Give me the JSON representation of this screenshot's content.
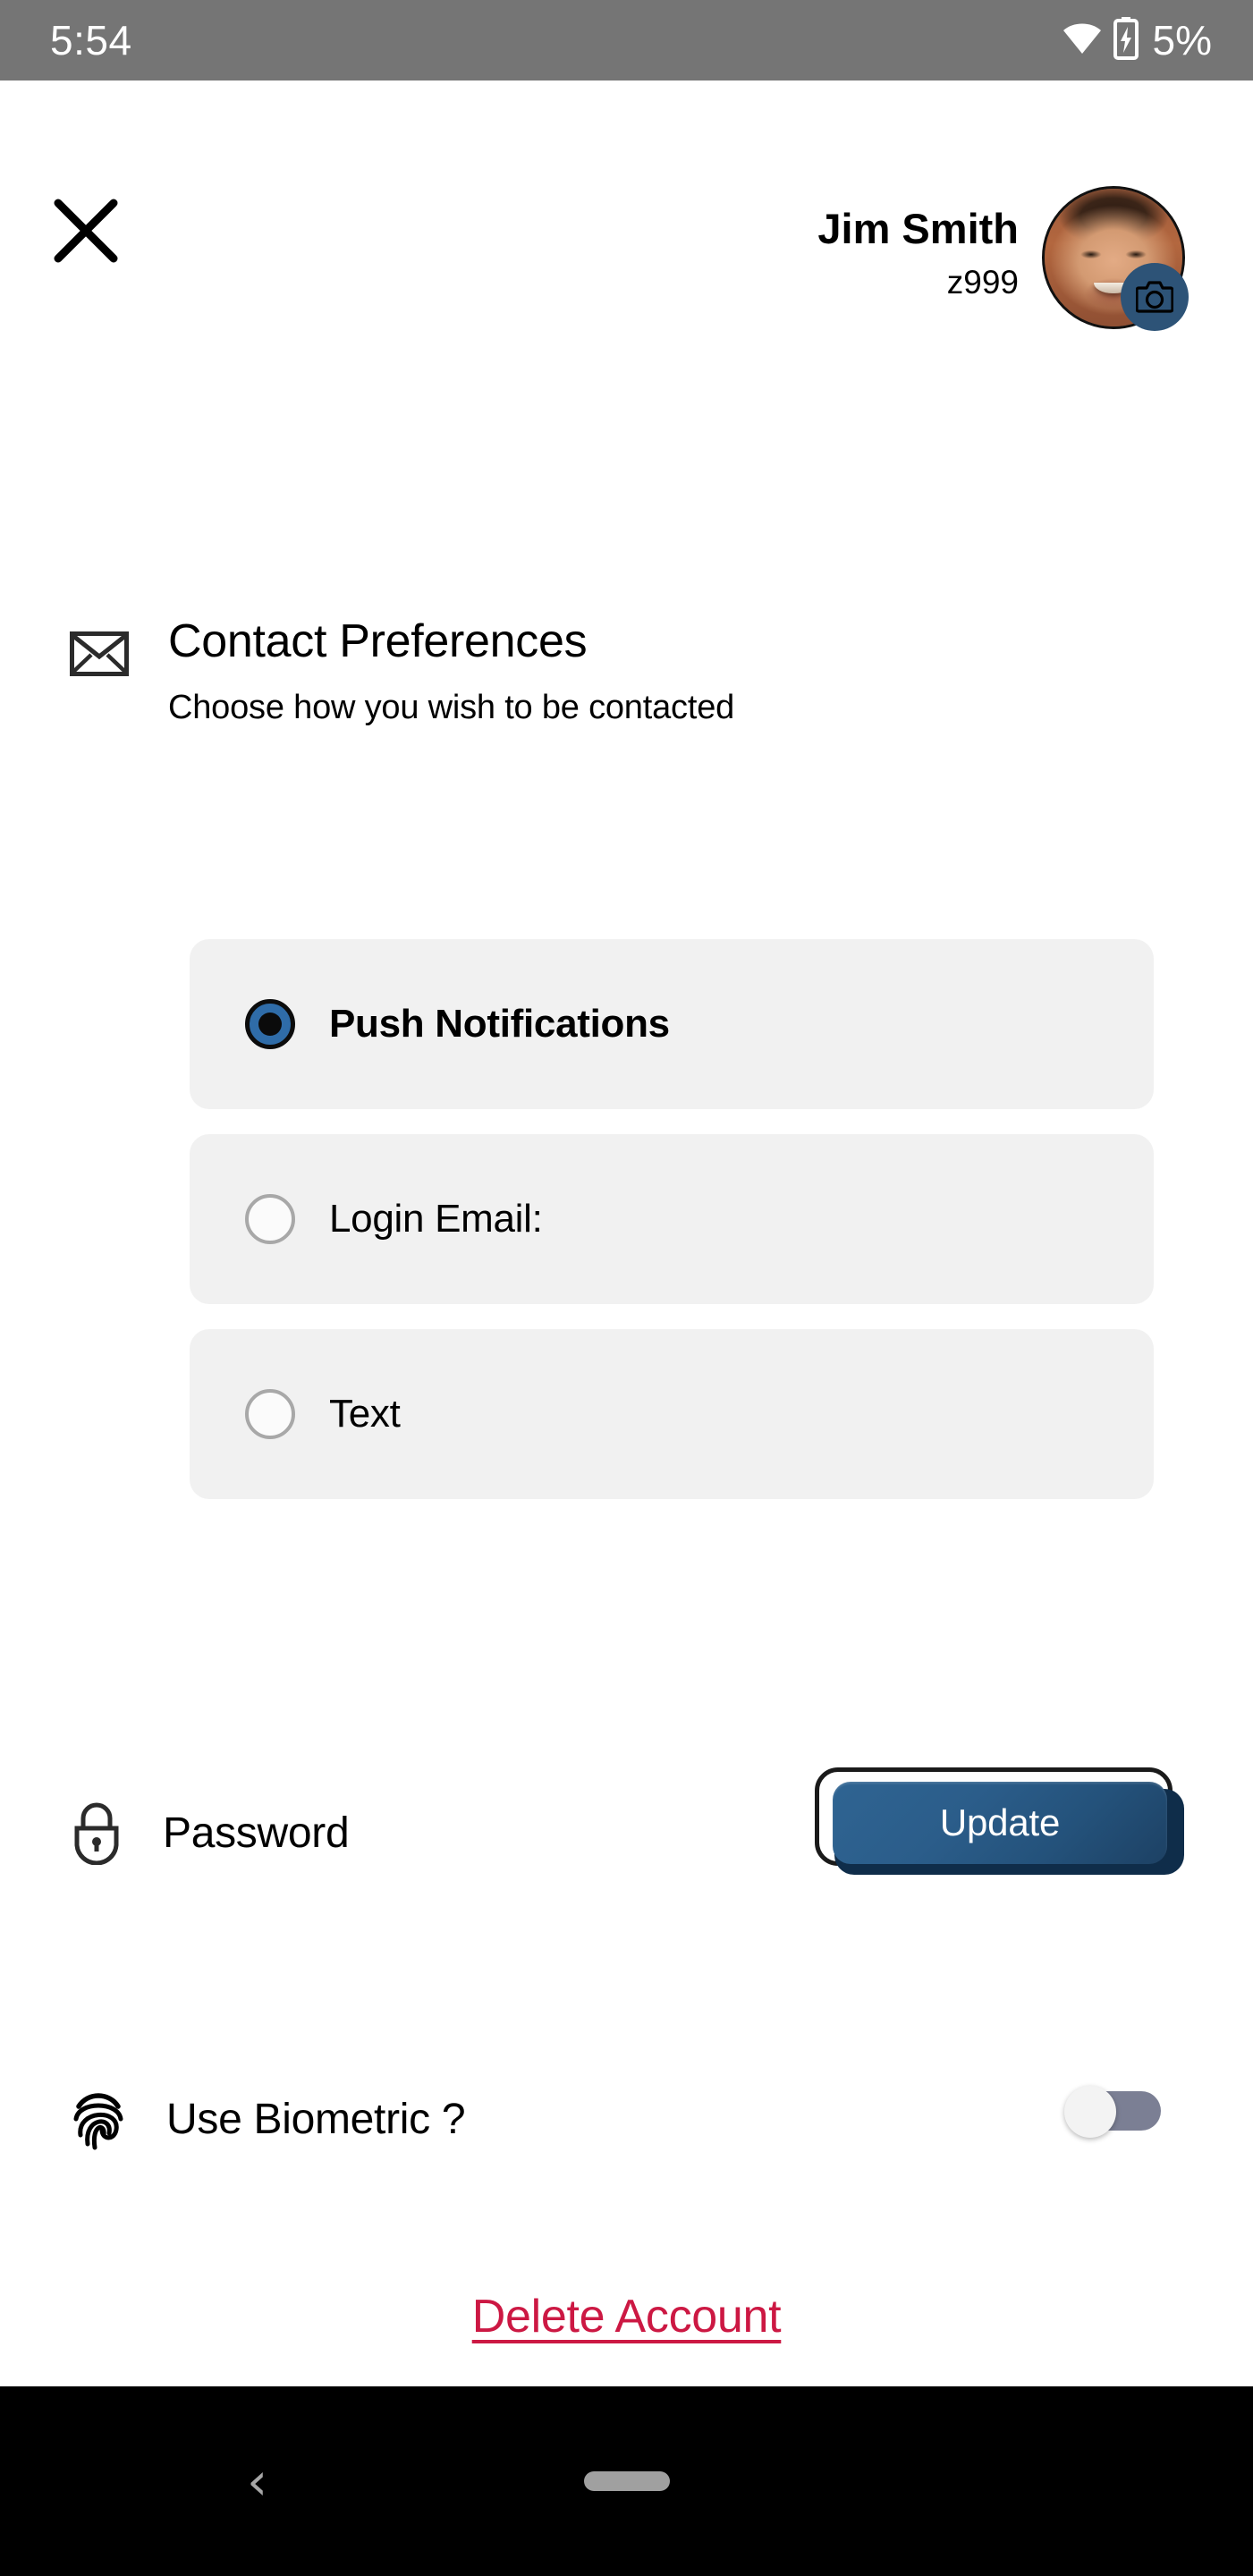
{
  "status_bar": {
    "time": "5:54",
    "battery_percent": "5%",
    "wifi_icon": "wifi-icon",
    "battery_icon": "battery-charging-icon"
  },
  "header": {
    "close_icon": "close-icon",
    "user_name": "Jim Smith",
    "user_id": "z999",
    "avatar_alt": "user-avatar",
    "camera_badge_icon": "camera-icon"
  },
  "contact_preferences": {
    "icon": "envelope-icon",
    "title": "Contact Preferences",
    "subtitle": "Choose how you wish to be contacted",
    "options": [
      {
        "label": "Push Notifications",
        "selected": true
      },
      {
        "label": "Login Email:",
        "selected": false
      },
      {
        "label": "Text",
        "selected": false
      }
    ]
  },
  "password": {
    "icon": "lock-icon",
    "label": "Password",
    "button_label": "Update"
  },
  "biometric": {
    "icon": "fingerprint-icon",
    "label": "Use Biometric ?",
    "toggle_state": "off"
  },
  "delete_account": {
    "label": "Delete Account"
  },
  "nav_bar": {
    "back_icon": "back-chevron-icon",
    "back_glyph": "‹",
    "home_indicator": "home-pill-indicator"
  },
  "colors": {
    "status_bar_bg": "#757575",
    "card_bg": "#f1f1f1",
    "radio_selected": "#2f6ca8",
    "update_button": "#2b5d8a",
    "camera_badge": "#2d5377",
    "delete_link": "#cc1843",
    "toggle_track": "#7b7f94",
    "nav_bar_bg": "#000000"
  }
}
